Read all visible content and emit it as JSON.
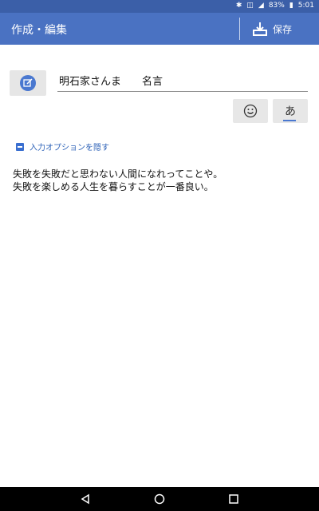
{
  "status": {
    "battery": "83%",
    "time": "5:01"
  },
  "toolbar": {
    "title": "作成・編集",
    "save_label": "保存"
  },
  "editor": {
    "title_value": "明石家さんま　　名言",
    "kana_button": "あ",
    "toggle_label": "入力オプションを隠す",
    "body_lines": [
      "失敗を失敗だと思わない人間になれってことや。",
      "失敗を楽しめる人生を暮らすことが一番良い。"
    ]
  },
  "colors": {
    "statusbar": "#3b5fa8",
    "toolbar": "#4a72c2",
    "accent": "#4a78d0"
  }
}
